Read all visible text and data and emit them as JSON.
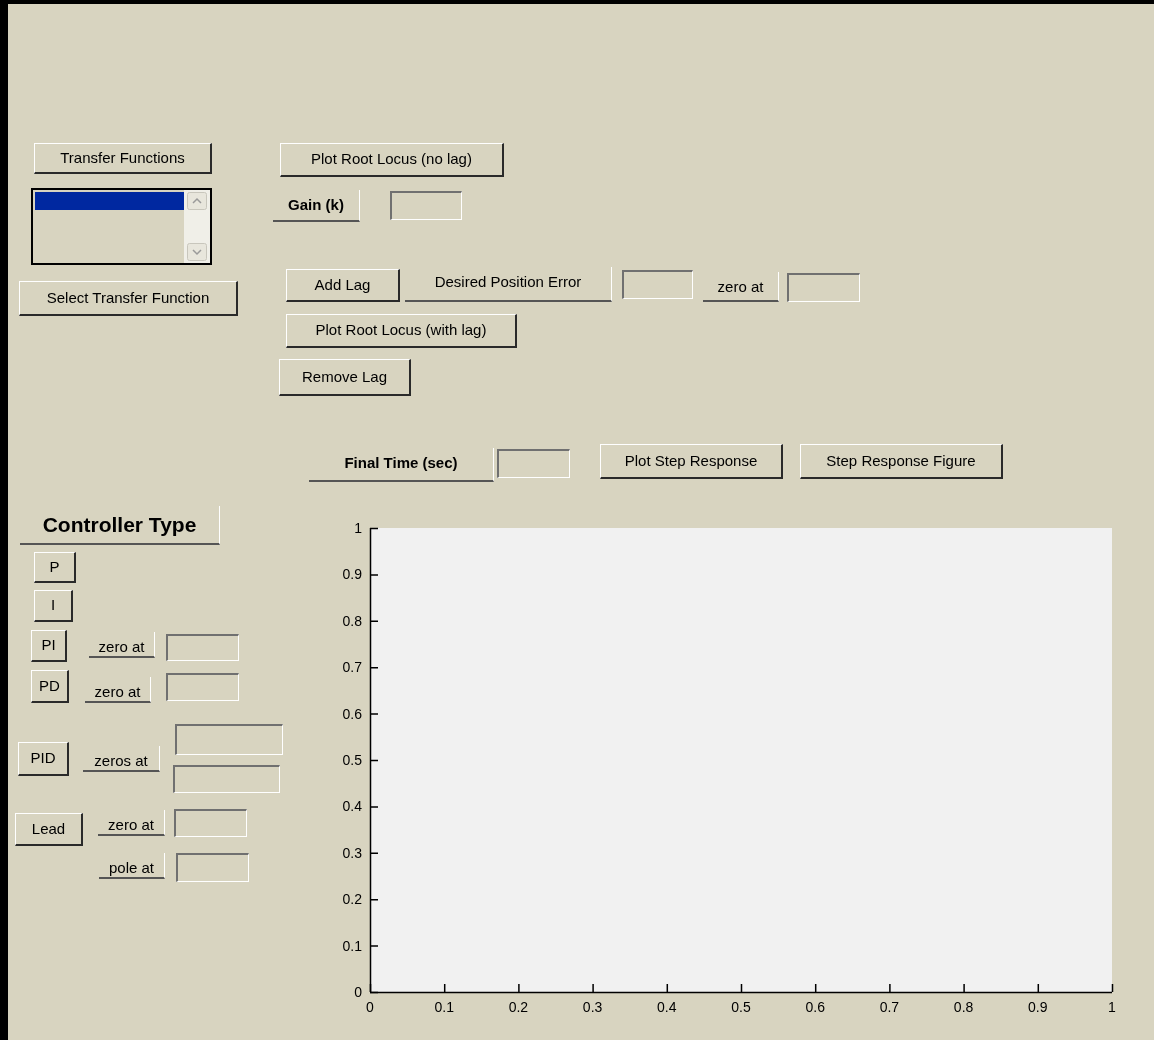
{
  "controls": [
    {
      "kind": "button",
      "text": "Transfer Functions"
    },
    {
      "kind": "button",
      "text": "Plot Root Locus (no lag)"
    },
    {
      "kind": "listbox",
      "rows": [
        {
          "selected": true
        }
      ]
    },
    {
      "kind": "label",
      "text": "Gain (k)",
      "bold": true
    },
    {
      "kind": "field"
    },
    {
      "kind": "button",
      "text": "Add Lag"
    },
    {
      "kind": "label",
      "text": "Desired Position Error",
      "bold": false
    },
    {
      "kind": "field"
    },
    {
      "kind": "label",
      "text": "zero at",
      "bold": false
    },
    {
      "kind": "field"
    },
    {
      "kind": "button",
      "text": "Select Transfer Function"
    },
    {
      "kind": "button",
      "text": "Plot Root Locus (with lag)"
    },
    {
      "kind": "button",
      "text": "Remove Lag"
    },
    {
      "kind": "label",
      "text": "Final Time (sec)",
      "bold": true
    },
    {
      "kind": "field"
    },
    {
      "kind": "button",
      "text": "Plot Step Response"
    },
    {
      "kind": "button",
      "text": "Step Response Figure"
    },
    {
      "kind": "label",
      "text": "Controller Type",
      "bold": true
    },
    {
      "kind": "button",
      "text": "P"
    },
    {
      "kind": "button",
      "text": "I"
    },
    {
      "kind": "button",
      "text": "PI"
    },
    {
      "kind": "label",
      "text": "zero at",
      "bold": false
    },
    {
      "kind": "field"
    },
    {
      "kind": "button",
      "text": "PD"
    },
    {
      "kind": "label",
      "text": "zero at",
      "bold": false
    },
    {
      "kind": "field"
    },
    {
      "kind": "button",
      "text": "PID"
    },
    {
      "kind": "label",
      "text": "zeros at",
      "bold": false
    },
    {
      "kind": "field"
    },
    {
      "kind": "field"
    },
    {
      "kind": "button",
      "text": "Lead"
    },
    {
      "kind": "label",
      "text": "zero at",
      "bold": false
    },
    {
      "kind": "field"
    },
    {
      "kind": "label",
      "text": "pole at",
      "bold": false
    },
    {
      "kind": "field"
    }
  ],
  "axes": {
    "chart_data": {
      "type": "line",
      "xlim": [
        0,
        1
      ],
      "ylim": [
        0,
        1
      ],
      "xticks": [
        0,
        0.1,
        0.2,
        0.3,
        0.4,
        0.5,
        0.6,
        0.7,
        0.8,
        0.9,
        1
      ],
      "yticks": [
        0,
        0.1,
        0.2,
        0.3,
        0.4,
        0.5,
        0.6,
        0.7,
        0.8,
        0.9,
        1
      ]
    }
  }
}
